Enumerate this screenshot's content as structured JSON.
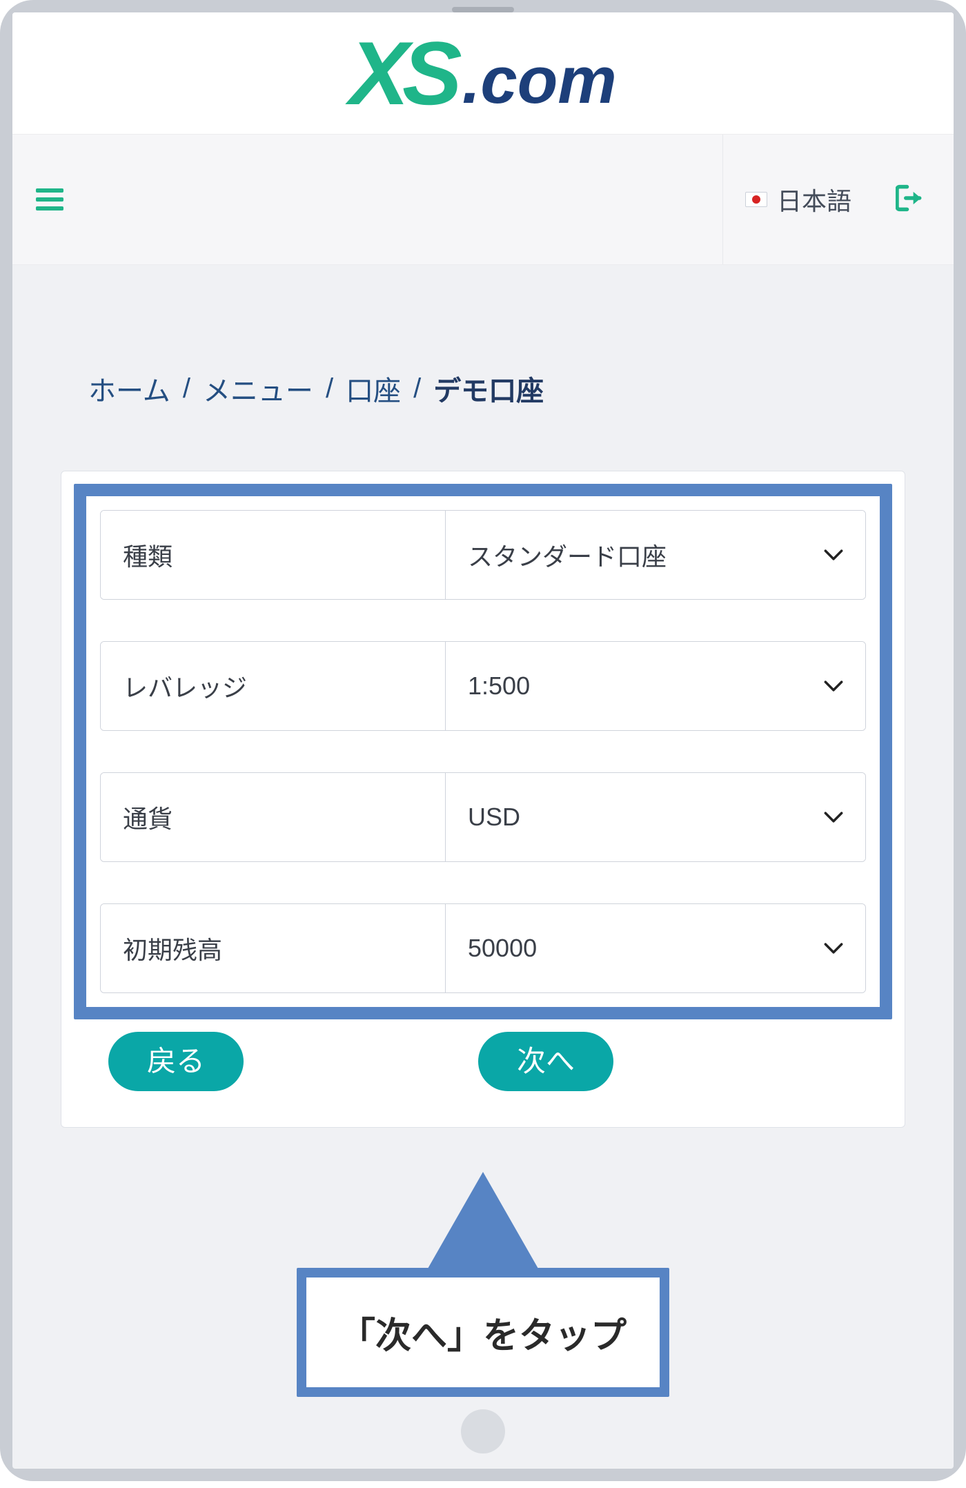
{
  "brand": {
    "xs": "XS",
    "dotcom": ".com"
  },
  "nav": {
    "language_label": "日本語"
  },
  "breadcrumb": {
    "home": "ホーム",
    "menu": "メニュー",
    "accounts": "口座",
    "current": "デモ口座",
    "sep": "/"
  },
  "form": {
    "rows": [
      {
        "label": "種類",
        "value": "スタンダード口座"
      },
      {
        "label": "レバレッジ",
        "value": "1:500"
      },
      {
        "label": "通貨",
        "value": "USD"
      },
      {
        "label": "初期残高",
        "value": "50000"
      }
    ]
  },
  "buttons": {
    "back": "戻る",
    "next": "次へ"
  },
  "callout": {
    "text": "「次へ」をタップ"
  },
  "colors": {
    "accent": "#1fb589",
    "highlight": "#5784c4",
    "primary_btn": "#0aa7a7"
  }
}
